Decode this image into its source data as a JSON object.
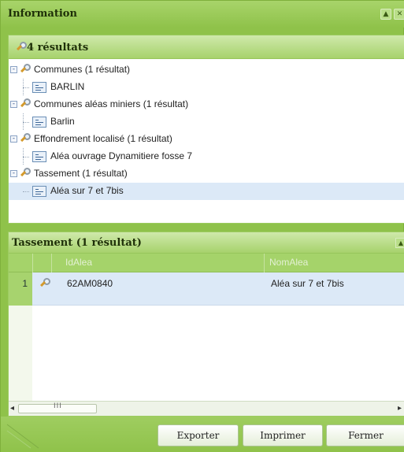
{
  "window": {
    "title": "Information"
  },
  "results": {
    "heading": "4 résultats",
    "tree": [
      {
        "label": "Communes (1 résultat)",
        "child": "BARLIN"
      },
      {
        "label": "Communes aléas miniers (1 résultat)",
        "child": "Barlin"
      },
      {
        "label": "Effondrement localisé (1 résultat)",
        "child": "Aléa ouvrage Dynamitiere fosse 7"
      },
      {
        "label": "Tassement (1 résultat)",
        "child": "Aléa sur 7 et 7bis",
        "child_selected": true
      }
    ]
  },
  "grid": {
    "title": "Tassement (1 résultat)",
    "columns": [
      "IdAlea",
      "NomAlea"
    ],
    "rows": [
      {
        "num": "1",
        "idalea": "62AM0840",
        "nomalea": "Aléa sur 7 et 7bis"
      }
    ],
    "scroll_thumb_grip": "III"
  },
  "footer": {
    "export_label": "Exporter",
    "print_label": "Imprimer",
    "close_label": "Fermer"
  },
  "icons": {
    "result_node": "magnifier-icon",
    "leaf_node": "record-icon",
    "expanded": "minus-icon"
  },
  "colors": {
    "frame": "#8fc24a",
    "header": "#a7d26c",
    "selected_row": "#dce9f7"
  }
}
